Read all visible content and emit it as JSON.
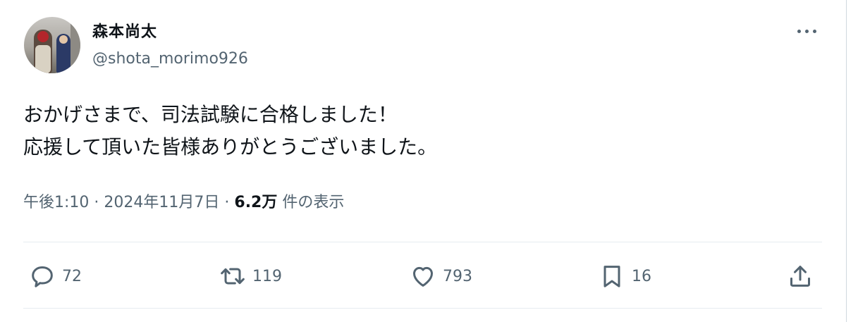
{
  "user": {
    "display_name": "森本尚太",
    "handle": "@shota_morimo926"
  },
  "tweet": {
    "line1": "おかげさまで、司法試験に合格しました！",
    "line2": "応援して頂いた皆様ありがとうございました。"
  },
  "meta": {
    "time": "午後1:10",
    "sep": "·",
    "date": "2024年11月7日",
    "views": "6.2万",
    "views_label": "件の表示"
  },
  "actions": {
    "reply": {
      "icon": "reply-icon",
      "count": "72"
    },
    "retweet": {
      "icon": "retweet-icon",
      "count": "119"
    },
    "like": {
      "icon": "heart-icon",
      "count": "793"
    },
    "bookmark": {
      "icon": "bookmark-icon",
      "count": "16"
    },
    "share": {
      "icon": "share-icon"
    }
  },
  "colors": {
    "text": "#0f1419",
    "secondary": "#536471",
    "divider": "#e6ecf0"
  }
}
